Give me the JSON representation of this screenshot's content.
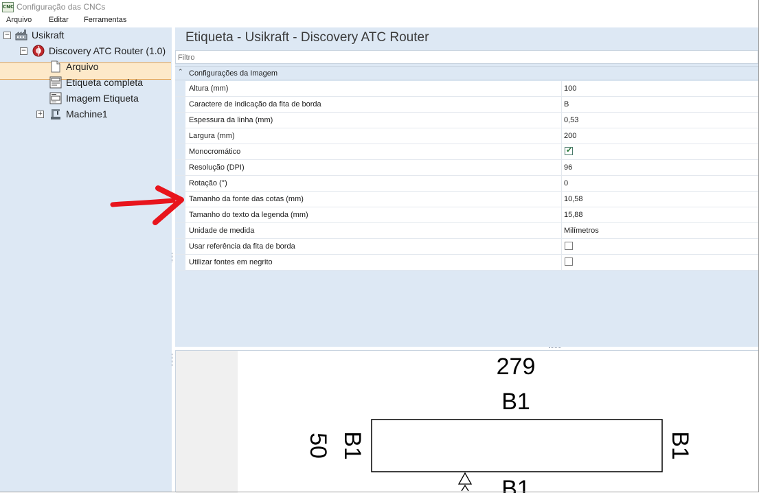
{
  "window": {
    "title": "Configuração das CNCs",
    "icon": "cnc-app-icon",
    "icon_text": "CNC"
  },
  "menu": [
    {
      "label": "Arquivo"
    },
    {
      "label": "Editar"
    },
    {
      "label": "Ferramentas"
    }
  ],
  "tree": {
    "root": {
      "label": "Usikraft",
      "icon": "factory-icon",
      "expanded": true
    },
    "machine": {
      "label": "Discovery ATC Router (1.0)",
      "icon": "router-icon",
      "expanded": true
    },
    "children": [
      {
        "label": "Arquivo",
        "icon": "file-icon"
      },
      {
        "label": "Etiqueta completa",
        "icon": "label-icon"
      },
      {
        "label": "Imagem Etiqueta",
        "icon": "label-image-icon",
        "selected": true
      }
    ],
    "sub": {
      "label": "Machine1",
      "icon": "machine-icon",
      "expanded": false
    }
  },
  "panel": {
    "heading": "Etiqueta - Usikraft - Discovery ATC Router",
    "filter_placeholder": "Filtro",
    "category": "Configurações da Imagem",
    "properties": [
      {
        "name": "Altura (mm)",
        "value": "100",
        "type": "text"
      },
      {
        "name": "Caractere de indicação da fita de borda",
        "value": "B",
        "type": "text"
      },
      {
        "name": "Espessura da linha (mm)",
        "value": "0,53",
        "type": "text"
      },
      {
        "name": "Largura (mm)",
        "value": "200",
        "type": "text"
      },
      {
        "name": "Monocromático",
        "value": true,
        "type": "checkbox"
      },
      {
        "name": "Resolução (DPI)",
        "value": "96",
        "type": "text"
      },
      {
        "name": "Rotação (°)",
        "value": "0",
        "type": "text"
      },
      {
        "name": "Tamanho da fonte das cotas (mm)",
        "value": "10,58",
        "type": "text"
      },
      {
        "name": "Tamanho do texto da legenda (mm)",
        "value": "15,88",
        "type": "text"
      },
      {
        "name": "Unidade de medida",
        "value": "Milímetros",
        "type": "text"
      },
      {
        "name": "Usar referência da fita de borda",
        "value": false,
        "type": "checkbox"
      },
      {
        "name": "Utilizar fontes em negrito",
        "value": false,
        "type": "checkbox"
      }
    ]
  },
  "preview": {
    "width_label": "279",
    "top_edge": "B1",
    "left_edge": "B1",
    "height_label": "50",
    "right_edge": "B1",
    "bottom_edge": "B1"
  },
  "colors": {
    "sidebar_bg": "#dde8f4",
    "selection_bg": "#fde9c9",
    "selection_border": "#e9a34a",
    "annotation_arrow": "#e8141c"
  }
}
